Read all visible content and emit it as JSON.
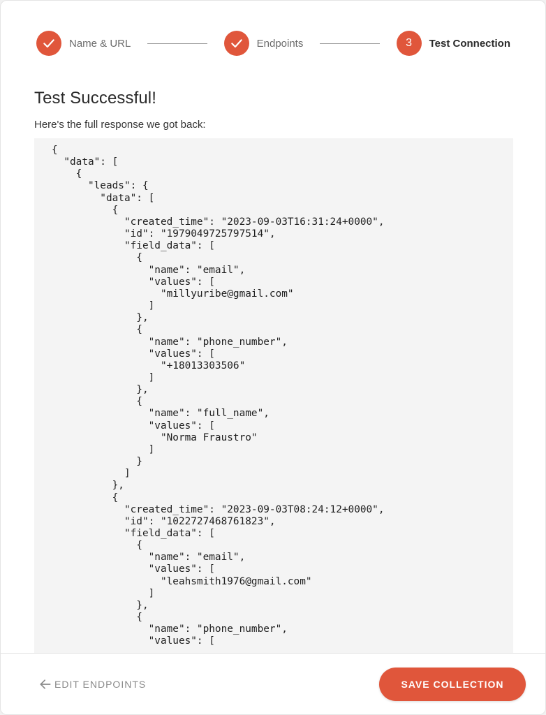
{
  "stepper": {
    "steps": [
      {
        "label": "Name & URL",
        "status": "complete"
      },
      {
        "label": "Endpoints",
        "status": "complete"
      },
      {
        "label": "Test Connection",
        "status": "active",
        "number": "3"
      }
    ]
  },
  "content": {
    "title": "Test Successful!",
    "subtitle": "Here's the full response we got back:",
    "response_text": "{\n  \"data\": [\n    {\n      \"leads\": {\n        \"data\": [\n          {\n            \"created_time\": \"2023-09-03T16:31:24+0000\",\n            \"id\": \"1979049725797514\",\n            \"field_data\": [\n              {\n                \"name\": \"email\",\n                \"values\": [\n                  \"millyuribe@gmail.com\"\n                ]\n              },\n              {\n                \"name\": \"phone_number\",\n                \"values\": [\n                  \"+18013303506\"\n                ]\n              },\n              {\n                \"name\": \"full_name\",\n                \"values\": [\n                  \"Norma Fraustro\"\n                ]\n              }\n            ]\n          },\n          {\n            \"created_time\": \"2023-09-03T08:24:12+0000\",\n            \"id\": \"1022727468761823\",\n            \"field_data\": [\n              {\n                \"name\": \"email\",\n                \"values\": [\n                  \"leahsmith1976@gmail.com\"\n                ]\n              },\n              {\n                \"name\": \"phone_number\",\n                \"values\": ["
  },
  "footer": {
    "back_label": "EDIT ENDPOINTS",
    "save_label": "SAVE COLLECTION"
  },
  "colors": {
    "accent": "#e0563b",
    "code_background": "#f4f4f4"
  },
  "icons": {
    "step_complete": "check-icon",
    "back": "arrow-left-icon"
  }
}
